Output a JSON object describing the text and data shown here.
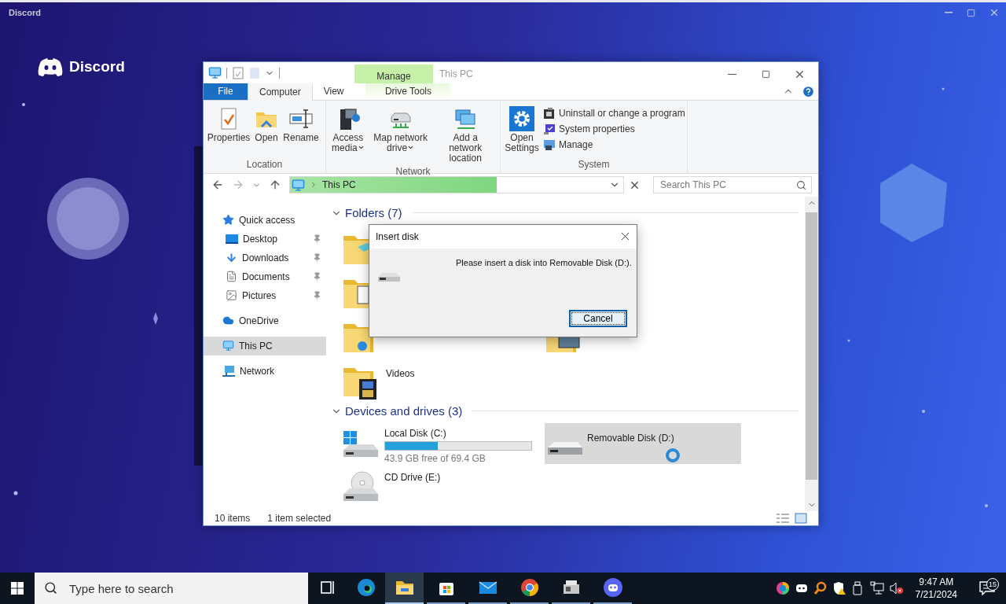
{
  "app_bar": {
    "title": "Discord",
    "brand": "Discord"
  },
  "explorer": {
    "title": "This PC",
    "context_tab": {
      "label": "Manage"
    },
    "tabs": [
      {
        "label": "File",
        "kind": "file",
        "selected": false
      },
      {
        "label": "Computer",
        "kind": "tab",
        "selected": true
      },
      {
        "label": "View",
        "kind": "tab",
        "selected": false
      },
      {
        "label": "Drive Tools",
        "kind": "context",
        "selected": false
      }
    ],
    "ribbon": [
      {
        "label": "Location",
        "buttons": [
          {
            "label": "Properties",
            "kind": "properties",
            "dropdown": false
          },
          {
            "label": "Open",
            "kind": "open",
            "dropdown": false
          },
          {
            "label": "Rename",
            "kind": "rename",
            "dropdown": false
          }
        ]
      },
      {
        "label": "Network",
        "buttons": [
          {
            "label": "Access media",
            "kind": "media",
            "dropdown": true
          },
          {
            "label": "Map network drive",
            "kind": "mapdrive",
            "dropdown": true
          },
          {
            "label": "Add a network location",
            "kind": "netloc",
            "dropdown": false
          }
        ]
      },
      {
        "label": "System",
        "buttons": [
          {
            "label": "Open Settings",
            "kind": "settings",
            "dropdown": false
          }
        ],
        "items": [
          {
            "label": "Uninstall or change a program",
            "kind": "uninstall"
          },
          {
            "label": "System properties",
            "kind": "sysprops"
          },
          {
            "label": "Manage",
            "kind": "manage"
          }
        ]
      }
    ],
    "address": {
      "path": "This PC",
      "level": 0.62
    },
    "search": {
      "placeholder": "Search This PC"
    },
    "nav": [
      {
        "label": "Quick access",
        "kind": "star",
        "selected": false,
        "children": [
          {
            "label": "Desktop",
            "kind": "desktop",
            "pinned": true,
            "selected": false
          },
          {
            "label": "Downloads",
            "kind": "downloads",
            "pinned": true,
            "selected": false
          },
          {
            "label": "Documents",
            "kind": "documents",
            "pinned": true,
            "selected": false
          },
          {
            "label": "Pictures",
            "kind": "pictures",
            "pinned": true,
            "selected": false
          }
        ]
      },
      {
        "label": "OneDrive",
        "kind": "cloud",
        "selected": false
      },
      {
        "label": "This PC",
        "kind": "pc",
        "selected": true
      },
      {
        "label": "Network",
        "kind": "network",
        "selected": false
      }
    ],
    "folders": {
      "title": "Folders (7)",
      "expanded": true,
      "items": [
        {
          "kind": "objects3d"
        },
        {
          "kind": "documents"
        },
        {
          "kind": "music"
        },
        {
          "kind": "pictures"
        },
        {
          "kind": "videos",
          "name": "Videos"
        }
      ]
    },
    "drives": {
      "title": "Devices and drives (3)",
      "expanded": true,
      "items": [
        {
          "name": "Local Disk (C:)",
          "kind": "system",
          "level": 0.36,
          "space": "43.9 GB free of 69.4 GB",
          "selected": false,
          "busy": false
        },
        {
          "name": "Removable Disk (D:)",
          "kind": "removable",
          "selected": true,
          "busy": true
        },
        {
          "name": "CD Drive (E:)",
          "kind": "cd",
          "selected": false,
          "busy": false
        }
      ]
    },
    "status": {
      "count": "10 items",
      "selection": "1 item selected"
    },
    "dialog": {
      "title": "Insert disk",
      "message": "Please insert a disk into Removable Disk (D:).",
      "button": {
        "label": "Cancel",
        "focused": true
      }
    }
  },
  "taskbar": {
    "search": {
      "placeholder": "Type here to search"
    },
    "apps": [
      {
        "kind": "taskview",
        "running": false,
        "selected": false
      },
      {
        "kind": "edge",
        "running": false,
        "selected": false
      },
      {
        "kind": "explorer",
        "running": true,
        "selected": true
      },
      {
        "kind": "store",
        "running": true,
        "selected": false
      },
      {
        "kind": "mail",
        "running": true,
        "selected": false
      },
      {
        "kind": "chrome",
        "running": true,
        "selected": false
      },
      {
        "kind": "app",
        "running": true,
        "selected": false
      },
      {
        "kind": "discord",
        "running": true,
        "selected": false
      }
    ],
    "tray": [
      {
        "kind": "colorwheel"
      },
      {
        "kind": "discord"
      },
      {
        "kind": "magnifier"
      },
      {
        "kind": "shield"
      },
      {
        "kind": "usb"
      },
      {
        "kind": "network"
      },
      {
        "kind": "volume-muted"
      }
    ],
    "time": "9:47 AM",
    "date": "7/21/2024",
    "notifications": "15"
  }
}
